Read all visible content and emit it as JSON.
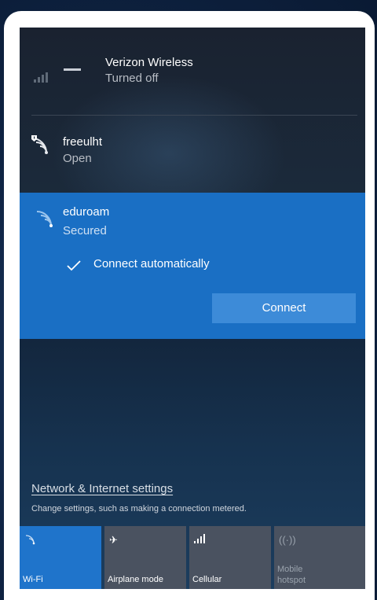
{
  "cellular": {
    "name": "Verizon Wireless",
    "status": "Turned off"
  },
  "networks": [
    {
      "name": "freeulht",
      "status": "Open"
    },
    {
      "name": "eduroam",
      "status": "Secured"
    }
  ],
  "selected": {
    "auto_connect_label": "Connect automatically",
    "connect_button": "Connect"
  },
  "settings": {
    "link": "Network & Internet settings",
    "description": "Change settings, such as making a connection metered."
  },
  "tiles": {
    "wifi": "Wi-Fi",
    "airplane": "Airplane mode",
    "cellular": "Cellular",
    "hotspot_line1": "Mobile",
    "hotspot_line2": "hotspot"
  },
  "colors": {
    "accent": "#1a6fc4",
    "button": "#3d8bd8",
    "tile": "#4a5260"
  },
  "icons": [
    "signal-bars-icon",
    "carrier-logo-icon",
    "wifi-open-icon",
    "wifi-secured-icon",
    "checkmark-icon",
    "airplane-icon",
    "hotspot-icon"
  ]
}
